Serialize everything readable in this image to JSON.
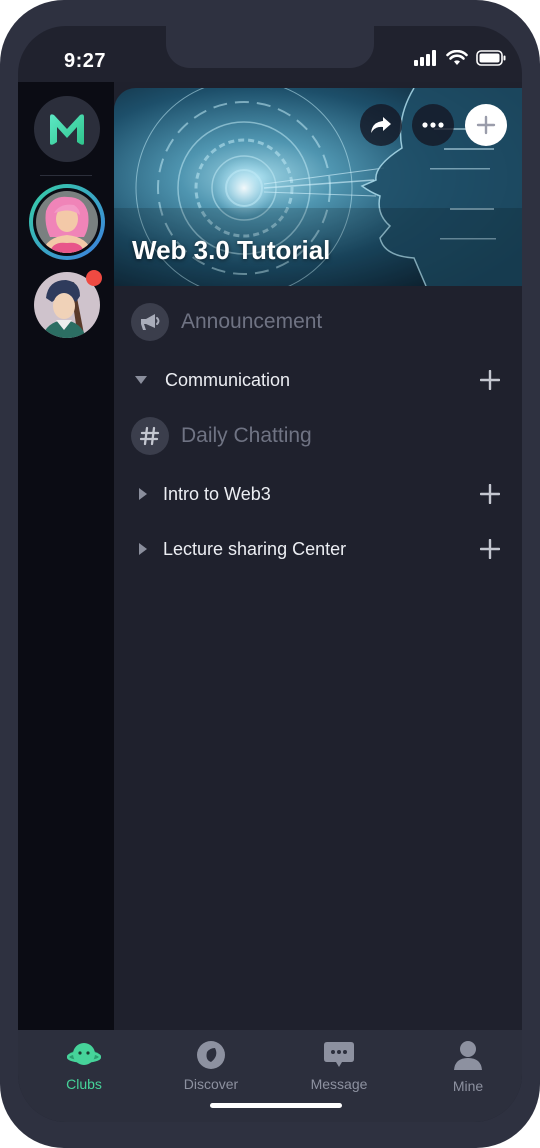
{
  "status_bar": {
    "time": "9:27"
  },
  "header": {
    "title": "Web 3.0 Tutorial"
  },
  "channels": {
    "announcement": "Announcement",
    "categories": [
      {
        "name": "Communication",
        "expanded": true
      },
      {
        "name": "Intro to Web3",
        "expanded": false
      },
      {
        "name": "Lecture sharing Center",
        "expanded": false
      }
    ],
    "daily": "Daily Chatting"
  },
  "tabs": [
    {
      "label": "Clubs",
      "icon": "planet-icon",
      "active": true
    },
    {
      "label": "Discover",
      "icon": "compass-icon",
      "active": false
    },
    {
      "label": "Message",
      "icon": "chat-bubble-icon",
      "active": false
    },
    {
      "label": "Mine",
      "icon": "person-icon",
      "active": false
    }
  ],
  "colors": {
    "accent": "#46d39a",
    "background": "#1f212d",
    "rail": "#0b0c14",
    "badge": "#ef4a42"
  }
}
